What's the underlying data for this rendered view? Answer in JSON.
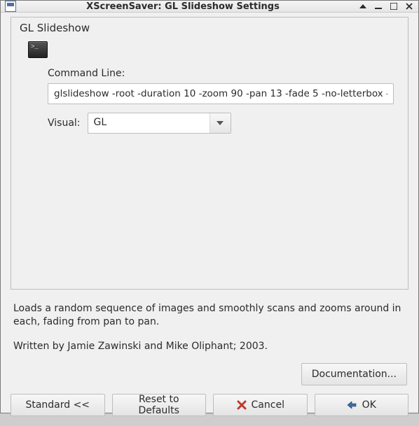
{
  "window": {
    "title": "XScreenSaver: GL Slideshow Settings"
  },
  "panel": {
    "title": "GL Slideshow",
    "command_line_label": "Command Line:",
    "command_line_value": "glslideshow -root -duration 10 -zoom 90 -pan 13 -fade 5 -no-letterbox -titles",
    "visual_label": "Visual:",
    "visual_value": "GL"
  },
  "description": {
    "p1": "Loads a random sequence of images and smoothly scans and zooms around in each, fading from pan to pan.",
    "p2": "Written by Jamie Zawinski and Mike Oliphant; 2003."
  },
  "buttons": {
    "documentation": "Documentation...",
    "standard": "Standard <<",
    "reset": "Reset to Defaults",
    "cancel": "Cancel",
    "ok": "OK"
  }
}
